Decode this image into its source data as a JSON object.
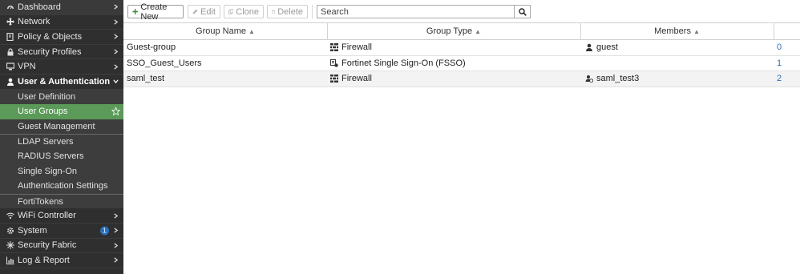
{
  "sidebar": {
    "items": [
      {
        "label": "Dashboard",
        "icon": "dashboard-icon"
      },
      {
        "label": "Network",
        "icon": "network-icon"
      },
      {
        "label": "Policy & Objects",
        "icon": "policy-icon"
      },
      {
        "label": "Security Profiles",
        "icon": "lock-icon"
      },
      {
        "label": "VPN",
        "icon": "monitor-icon"
      },
      {
        "label": "User & Authentication",
        "icon": "user-icon"
      },
      {
        "label": "User Definition"
      },
      {
        "label": "User Groups"
      },
      {
        "label": "Guest Management"
      },
      {
        "label": "LDAP Servers"
      },
      {
        "label": "RADIUS Servers"
      },
      {
        "label": "Single Sign-On"
      },
      {
        "label": "Authentication Settings"
      },
      {
        "label": "FortiTokens"
      },
      {
        "label": "WiFi Controller",
        "icon": "wifi-icon"
      },
      {
        "label": "System",
        "icon": "gear-icon",
        "badge": "1"
      },
      {
        "label": "Security Fabric",
        "icon": "fabric-icon"
      },
      {
        "label": "Log & Report",
        "icon": "chart-icon"
      }
    ]
  },
  "toolbar": {
    "create_label": "Create New",
    "edit_label": "Edit",
    "clone_label": "Clone",
    "delete_label": "Delete",
    "search_placeholder": "Search"
  },
  "table": {
    "columns": [
      "Group Name",
      "Group Type",
      "Members"
    ],
    "rows": [
      {
        "name": "Guest-group",
        "type": "Firewall",
        "type_icon": "firewall-icon",
        "members": "guest",
        "member_icon": "user-icon",
        "count": "0"
      },
      {
        "name": "SSO_Guest_Users",
        "type": "Fortinet Single Sign-On (FSSO)",
        "type_icon": "fsso-icon",
        "members": "",
        "member_icon": "",
        "count": "1"
      },
      {
        "name": "saml_test",
        "type": "Firewall",
        "type_icon": "firewall-icon",
        "members": "saml_test3",
        "member_icon": "saml-user-icon",
        "count": "2"
      }
    ]
  },
  "colors": {
    "sidebar_bg": "#2f2f2f",
    "active_bg": "#5b9a58",
    "link": "#2a6fbb",
    "create_icon": "#3b8b3b"
  }
}
